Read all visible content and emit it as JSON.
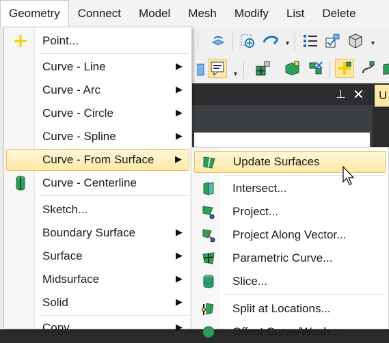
{
  "menubar": {
    "items": [
      "Geometry",
      "Connect",
      "Model",
      "Mesh",
      "Modify",
      "List",
      "Delete"
    ],
    "open_index": 0
  },
  "panel": {
    "pin_icon": "pin-icon",
    "close_icon": "close-icon",
    "tab_label": "U"
  },
  "geometry_menu": {
    "items": [
      {
        "label": "Point...",
        "icon": "point-plus-icon",
        "has_submenu": false
      },
      {
        "label": "Curve - Line",
        "has_submenu": true
      },
      {
        "label": "Curve - Arc",
        "has_submenu": true
      },
      {
        "label": "Curve - Circle",
        "has_submenu": true
      },
      {
        "label": "Curve - Spline",
        "has_submenu": true
      },
      {
        "label": "Curve - From Surface",
        "has_submenu": true,
        "highlighted": true
      },
      {
        "label": "Curve - Centerline",
        "icon": "cylinder-icon",
        "has_submenu": false
      },
      {
        "label": "Sketch...",
        "has_submenu": false
      },
      {
        "label": "Boundary Surface",
        "has_submenu": true
      },
      {
        "label": "Surface",
        "has_submenu": true
      },
      {
        "label": "Midsurface",
        "has_submenu": true
      },
      {
        "label": "Solid",
        "has_submenu": true
      },
      {
        "label": "Copy",
        "has_submenu": true
      }
    ]
  },
  "submenu": {
    "items": [
      {
        "label": "Update Surfaces",
        "icon": "update-surfaces-icon",
        "highlighted": true
      },
      {
        "label": "Intersect...",
        "icon": "intersect-icon"
      },
      {
        "label": "Project...",
        "icon": "project-icon"
      },
      {
        "label": "Project Along Vector...",
        "icon": "project-along-vector-icon"
      },
      {
        "label": "Parametric Curve...",
        "icon": "parametric-curve-icon"
      },
      {
        "label": "Slice...",
        "icon": "slice-icon"
      },
      {
        "label": "Split at Locations...",
        "icon": "split-at-locations-icon"
      },
      {
        "label": "Offset Curve/Wash...",
        "icon": "offset-curve-icon"
      }
    ]
  },
  "colors": {
    "highlight": "#fde9a6",
    "highlight_border": "#e8c26a",
    "accent_green": "#2e9e5b",
    "accent_blue": "#1f6fd1"
  }
}
